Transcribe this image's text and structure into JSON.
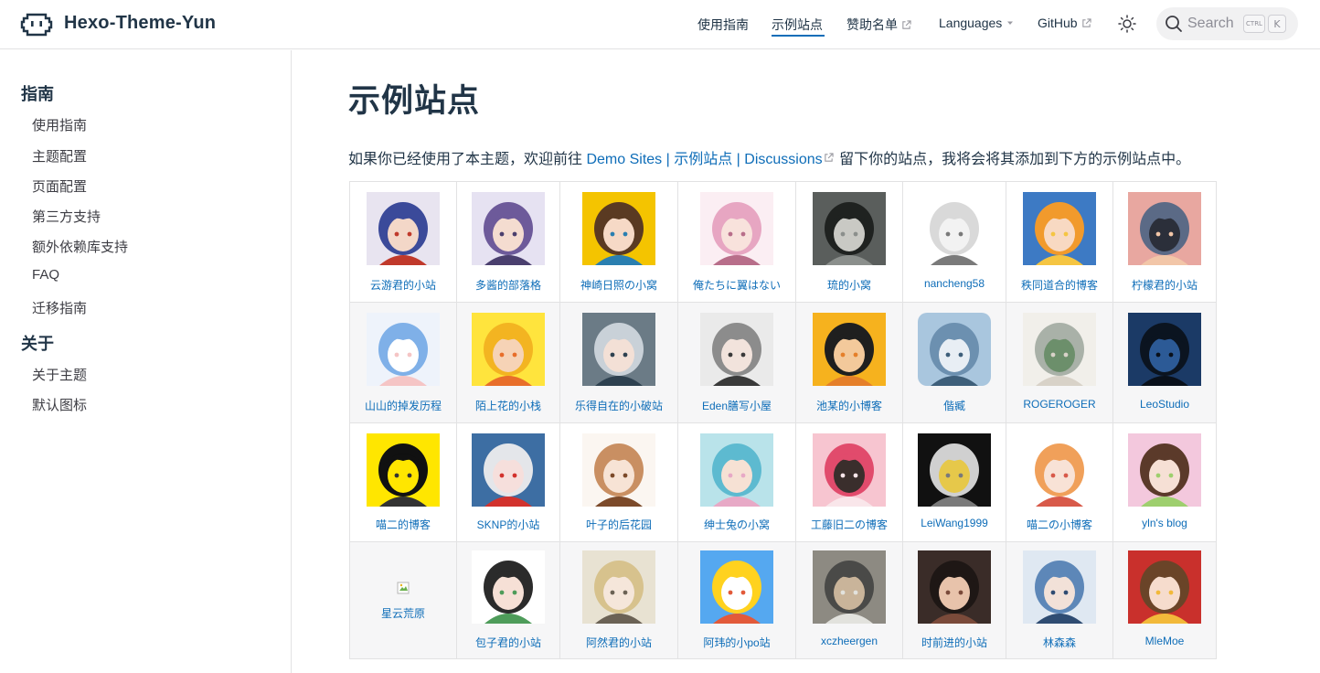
{
  "header": {
    "site_title": "Hexo-Theme-Yun",
    "nav": [
      {
        "label": "使用指南",
        "external": false,
        "active": false
      },
      {
        "label": "示例站点",
        "external": false,
        "active": true
      },
      {
        "label": "赞助名单",
        "external": true,
        "active": false
      },
      {
        "label": "Languages",
        "dropdown": true,
        "active": false
      },
      {
        "label": "GitHub",
        "external": true,
        "active": false
      }
    ],
    "search": {
      "placeholder": "Search",
      "key1": "CTRL",
      "key2": "K"
    },
    "accent": "#0e6db8"
  },
  "sidebar": {
    "groups": [
      {
        "title": "指南",
        "items": [
          "使用指南",
          "主题配置",
          "页面配置",
          "第三方支持",
          "额外依赖库支持",
          "FAQ",
          "迁移指南"
        ]
      },
      {
        "title": "关于",
        "items": [
          "关于主题",
          "默认图标"
        ]
      }
    ]
  },
  "main": {
    "title": "示例站点",
    "intro_before": "如果你已经使用了本主题，欢迎前往",
    "intro_link": "Demo Sites | 示例站点 | Discussions",
    "intro_after": "留下你的站点，我将会将其添加到下方的示例站点中。",
    "sites": [
      [
        {
          "name": "云游君的小站",
          "avatar": "anime-girl-blue-hair-horns-icon"
        },
        {
          "name": "多酱的部落格",
          "avatar": "anime-girl-purple-hair-icon"
        },
        {
          "name": "神崎日照の小窝",
          "avatar": "anime-girl-yellow-background-icon"
        },
        {
          "name": "俺たちに翼はない",
          "avatar": "anime-girl-bunny-ears-pink-icon"
        },
        {
          "name": "琉的小窝",
          "avatar": "grayscale-girl-photo-icon"
        },
        {
          "name": "nancheng58",
          "avatar": "hamster-sketch-icon"
        },
        {
          "name": "秩同道合的博客",
          "avatar": "anime-girl-orange-hair-icon"
        },
        {
          "name": "柠檬君的小站",
          "avatar": "sunset-silhouette-icon"
        }
      ],
      [
        {
          "name": "山山的掉发历程",
          "avatar": "chibi-girl-blanket-icon"
        },
        {
          "name": "陌上花的小栈",
          "avatar": "yellow-cat-hood-kid-icon"
        },
        {
          "name": "乐得自在的小破站",
          "avatar": "anime-girl-silver-hair-icon"
        },
        {
          "name": "Eden膳写小屋",
          "avatar": "anime-girl-gray-hair-icon"
        },
        {
          "name": "池某的小博客",
          "avatar": "cartoon-boy-cap-icon"
        },
        {
          "name": "偕臧",
          "avatar": "sleeping-anime-boy-icon"
        },
        {
          "name": "ROGEROGER",
          "avatar": "frog-painting-icon"
        },
        {
          "name": "LeoStudio",
          "avatar": "dark-blue-silhouette-icon"
        }
      ],
      [
        {
          "name": "喵二的博客",
          "avatar": "yellow-sketch-face-icon"
        },
        {
          "name": "SKNP的小站",
          "avatar": "anime-girl-shark-hood-icon"
        },
        {
          "name": "叶子的后花园",
          "avatar": "anime-girl-brown-hair-icon"
        },
        {
          "name": "绅士兔の小窝",
          "avatar": "anime-girl-teal-hair-icon"
        },
        {
          "name": "工藤旧二の博客",
          "avatar": "girl-pink-pattern-icon"
        },
        {
          "name": "LeiWang1999",
          "avatar": "dark-text-card-icon"
        },
        {
          "name": "喵二の小博客",
          "avatar": "anime-girl-salute-icon"
        },
        {
          "name": "yln's blog",
          "avatar": "anime-catgirl-flowers-icon"
        }
      ],
      [
        {
          "name": "星云荒原",
          "avatar": "broken-image-icon"
        },
        {
          "name": "包子君的小站",
          "avatar": "chibi-girl-sign-icon"
        },
        {
          "name": "阿然君的小站",
          "avatar": "anime-boy-blond-icon"
        },
        {
          "name": "阿玮的小po站",
          "avatar": "yellow-duck-icon"
        },
        {
          "name": "xczheergen",
          "avatar": "man-photo-icon"
        },
        {
          "name": "时前进的小站",
          "avatar": "woman-portrait-icon"
        },
        {
          "name": "林森森",
          "avatar": "anime-boy-blue-hair-icon"
        },
        {
          "name": "MleMoe",
          "avatar": "anime-girl-chibi-red-icon"
        }
      ]
    ]
  }
}
